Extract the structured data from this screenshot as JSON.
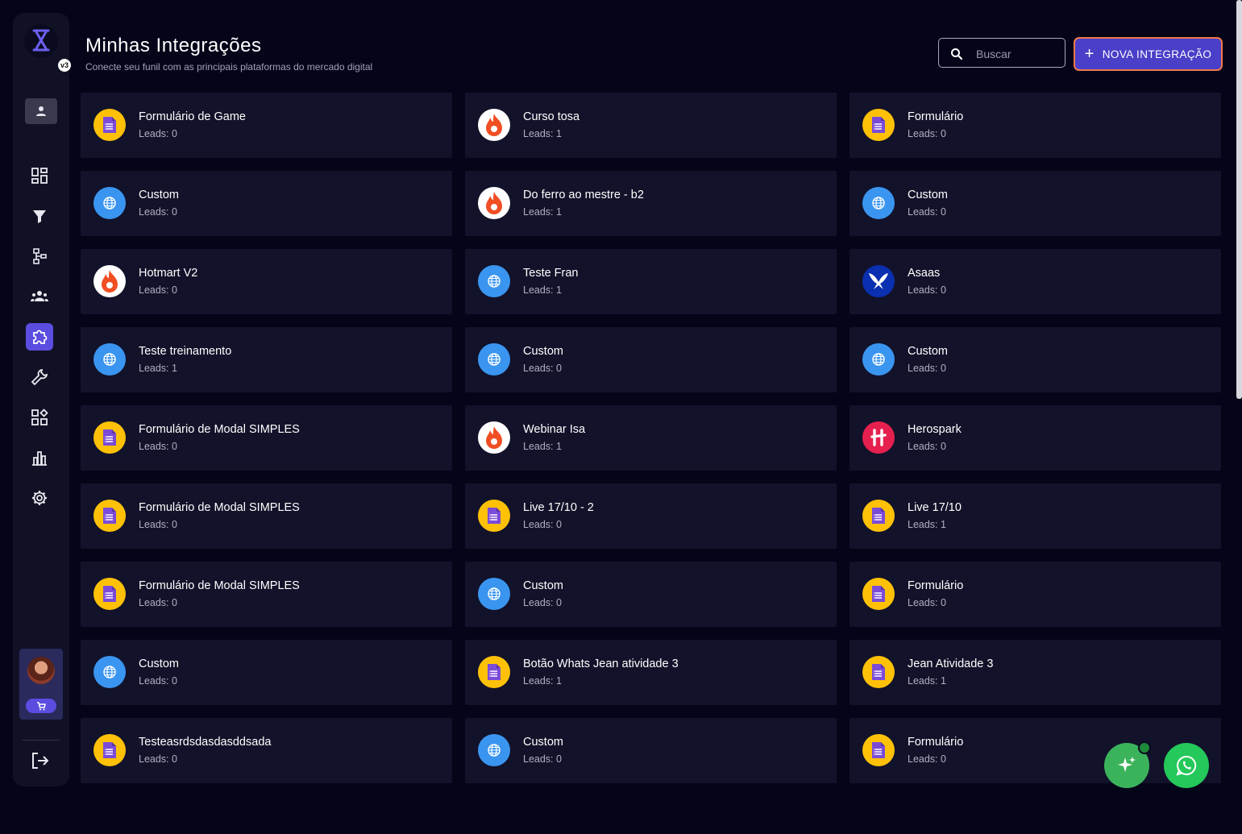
{
  "app": {
    "version_badge": "v3"
  },
  "header": {
    "title": "Minhas Integrações",
    "subtitle": "Conecte seu funil com as principais plataformas do mercado digital",
    "search_placeholder": "Buscar",
    "new_button_label": "NOVA INTEGRAÇÃO"
  },
  "sidebar": {
    "items": [
      {
        "icon": "dashboard-icon",
        "active": false
      },
      {
        "icon": "funnel-icon",
        "active": false
      },
      {
        "icon": "flow-icon",
        "active": false
      },
      {
        "icon": "team-icon",
        "active": false
      },
      {
        "icon": "puzzle-icon",
        "active": true
      },
      {
        "icon": "wrench-icon",
        "active": false
      },
      {
        "icon": "apps-icon",
        "active": false
      },
      {
        "icon": "bar-chart-icon",
        "active": false
      },
      {
        "icon": "gear-icon",
        "active": false
      }
    ]
  },
  "integrations": [
    {
      "name": "Formulário de Game",
      "leads": "Leads: 0",
      "type": "forms"
    },
    {
      "name": "Curso tosa",
      "leads": "Leads: 1",
      "type": "hotmart"
    },
    {
      "name": "Formulário",
      "leads": "Leads: 0",
      "type": "forms"
    },
    {
      "name": "Custom",
      "leads": "Leads: 0",
      "type": "custom"
    },
    {
      "name": "Do ferro ao mestre - b2",
      "leads": "Leads: 1",
      "type": "hotmart"
    },
    {
      "name": "Custom",
      "leads": "Leads: 0",
      "type": "custom"
    },
    {
      "name": "Hotmart V2",
      "leads": "Leads: 0",
      "type": "hotmart"
    },
    {
      "name": "Teste Fran",
      "leads": "Leads: 1",
      "type": "custom"
    },
    {
      "name": "Asaas",
      "leads": "Leads: 0",
      "type": "asaas"
    },
    {
      "name": "Teste treinamento",
      "leads": "Leads: 1",
      "type": "custom"
    },
    {
      "name": "Custom",
      "leads": "Leads: 0",
      "type": "custom"
    },
    {
      "name": "Custom",
      "leads": "Leads: 0",
      "type": "custom"
    },
    {
      "name": "Formulário de Modal SIMPLES",
      "leads": "Leads: 0",
      "type": "forms"
    },
    {
      "name": "Webinar Isa",
      "leads": "Leads: 1",
      "type": "hotmart"
    },
    {
      "name": "Herospark",
      "leads": "Leads: 0",
      "type": "herospark"
    },
    {
      "name": "Formulário de Modal SIMPLES",
      "leads": "Leads: 0",
      "type": "forms"
    },
    {
      "name": "Live 17/10 - 2",
      "leads": "Leads: 0",
      "type": "forms"
    },
    {
      "name": "Live 17/10",
      "leads": "Leads: 1",
      "type": "forms"
    },
    {
      "name": "Formulário de Modal SIMPLES",
      "leads": "Leads: 0",
      "type": "forms"
    },
    {
      "name": "Custom",
      "leads": "Leads: 0",
      "type": "custom"
    },
    {
      "name": "Formulário",
      "leads": "Leads: 0",
      "type": "forms"
    },
    {
      "name": "Custom",
      "leads": "Leads: 0",
      "type": "custom"
    },
    {
      "name": "Botão Whats Jean atividade 3",
      "leads": "Leads: 1",
      "type": "forms"
    },
    {
      "name": "Jean Atividade 3",
      "leads": "Leads: 1",
      "type": "forms"
    },
    {
      "name": "Testeasrdsdasdasddsada",
      "leads": "Leads: 0",
      "type": "forms"
    },
    {
      "name": "Custom",
      "leads": "Leads: 0",
      "type": "custom"
    },
    {
      "name": "Formulário",
      "leads": "Leads: 0",
      "type": "forms"
    }
  ],
  "colors": {
    "accent": "#5b4de0",
    "button_border": "#f07a4a",
    "forms": "#ffc107",
    "custom": "#3a95f0",
    "whatsapp": "#25c85a"
  }
}
